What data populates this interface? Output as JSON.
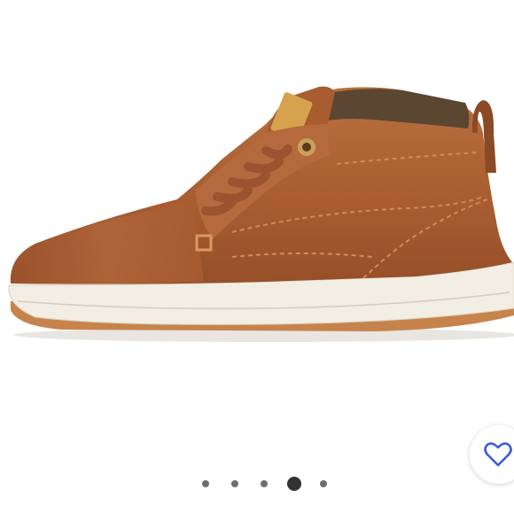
{
  "product_image": {
    "description_icon": "shoe-image"
  },
  "like_button": {
    "icon": "heart-outline-icon",
    "color": "#3b5bdb"
  },
  "carousel": {
    "total_slides": 5,
    "active_index": 3
  },
  "colors": {
    "leather": "#b0643a",
    "leather_dark": "#8a4a26",
    "collar": "#5a4630",
    "sole": "#f3efe4",
    "sole_bottom": "#c8864f",
    "dot_inactive": "#6e6e6e",
    "dot_active": "#333333"
  }
}
